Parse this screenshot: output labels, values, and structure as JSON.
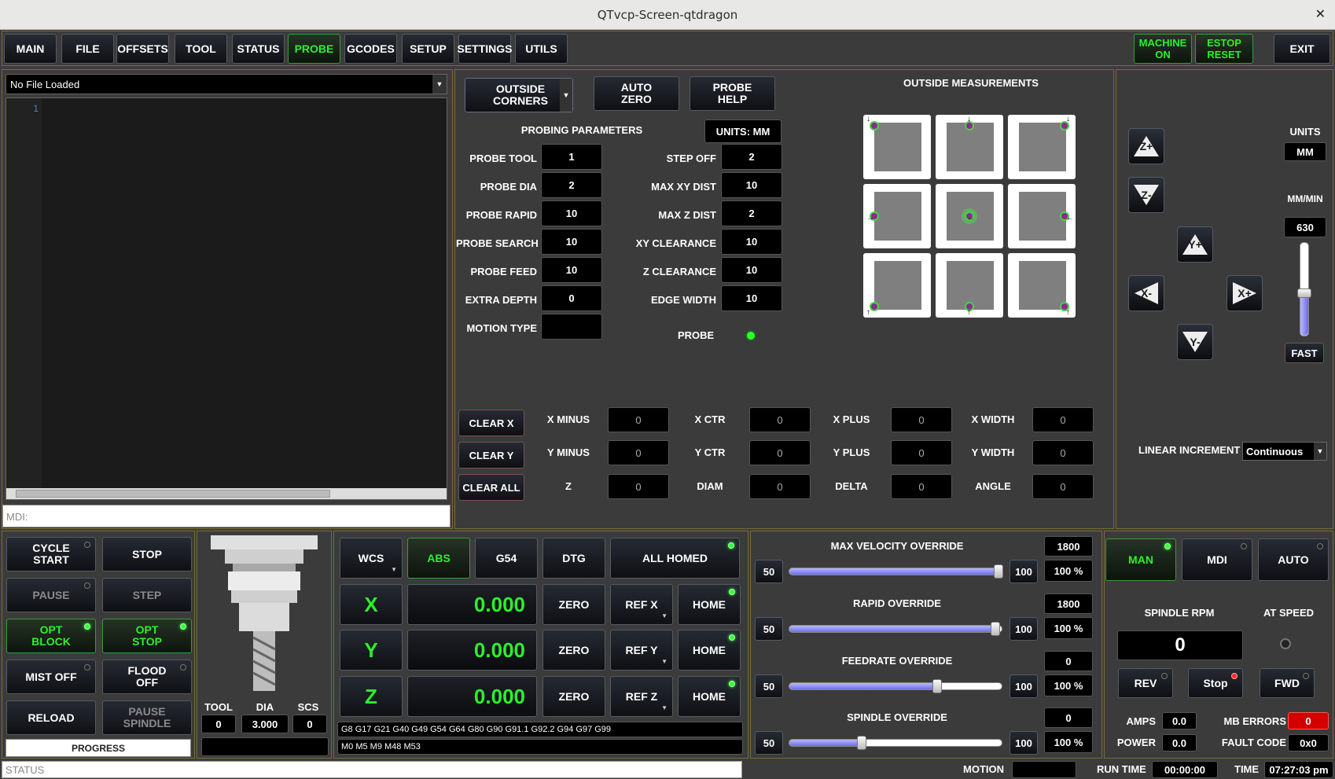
{
  "window": {
    "title": "QTvcp-Screen-qtdragon",
    "close": "✕"
  },
  "nav": {
    "tabs": [
      "MAIN",
      "FILE",
      "OFFSETS",
      "TOOL",
      "STATUS",
      "PROBE",
      "GCODES",
      "SETUP",
      "SETTINGS",
      "UTILS"
    ],
    "active": "PROBE",
    "machine_on": "MACHINE ON",
    "estop": "ESTOP RESET",
    "exit": "EXIT"
  },
  "file": {
    "loaded": "No File Loaded",
    "line1": "1",
    "mdi": "MDI:"
  },
  "probe": {
    "mode": "OUTSIDE CORNERS",
    "auto_zero": "AUTO ZERO",
    "help": "PROBE HELP",
    "params_title": "PROBING PARAMETERS",
    "units": "UNITS: MM",
    "left": [
      {
        "label": "PROBE TOOL",
        "value": "1"
      },
      {
        "label": "PROBE DIA",
        "value": "2"
      },
      {
        "label": "PROBE RAPID",
        "value": "10"
      },
      {
        "label": "PROBE SEARCH",
        "value": "10"
      },
      {
        "label": "PROBE FEED",
        "value": "10"
      },
      {
        "label": "EXTRA DEPTH",
        "value": "0"
      },
      {
        "label": "MOTION TYPE",
        "value": ""
      }
    ],
    "right": [
      {
        "label": "STEP OFF",
        "value": "2"
      },
      {
        "label": "MAX XY DIST",
        "value": "10"
      },
      {
        "label": "MAX Z DIST",
        "value": "2"
      },
      {
        "label": "XY CLEARANCE",
        "value": "10"
      },
      {
        "label": "Z CLEARANCE",
        "value": "10"
      },
      {
        "label": "EDGE WIDTH",
        "value": "10"
      }
    ],
    "probe_label": "PROBE",
    "measure_title": "OUTSIDE MEASUREMENTS",
    "clear_x": "CLEAR X",
    "clear_y": "CLEAR Y",
    "clear_all": "CLEAR ALL",
    "results": [
      [
        {
          "label": "X MINUS",
          "value": "0"
        },
        {
          "label": "X CTR",
          "value": "0"
        },
        {
          "label": "X PLUS",
          "value": "0"
        },
        {
          "label": "X WIDTH",
          "value": "0"
        }
      ],
      [
        {
          "label": "Y MINUS",
          "value": "0"
        },
        {
          "label": "Y CTR",
          "value": "0"
        },
        {
          "label": "Y PLUS",
          "value": "0"
        },
        {
          "label": "Y WIDTH",
          "value": "0"
        }
      ],
      [
        {
          "label": "Z",
          "value": "0"
        },
        {
          "label": "DIAM",
          "value": "0"
        },
        {
          "label": "DELTA",
          "value": "0"
        },
        {
          "label": "ANGLE",
          "value": "0"
        }
      ]
    ]
  },
  "jog": {
    "units_label": "UNITS",
    "units": "MM",
    "rate_label": "MM/MIN",
    "rate": "630",
    "fast": "FAST",
    "zplus": "Z+",
    "zminus": "Z-",
    "yplus": "Y+",
    "yminus": "Y-",
    "xplus": "X+",
    "xminus": "X-",
    "increment_label": "LINEAR INCREMENT",
    "increment": "Continuous",
    "slider_fraction": 0.45
  },
  "controls": {
    "cycle_start": "CYCLE START",
    "stop": "STOP",
    "pause": "PAUSE",
    "step": "STEP",
    "opt_block": "OPT BLOCK",
    "opt_stop": "OPT STOP",
    "mist": "MIST OFF",
    "flood": "FLOOD OFF",
    "reload": "RELOAD",
    "pause_spindle": "PAUSE SPINDLE",
    "progress": "PROGRESS"
  },
  "tool": {
    "tool_label": "TOOL",
    "dia_label": "DIA",
    "scs_label": "SCS",
    "tool": "0",
    "dia": "3.000",
    "scs": "0"
  },
  "dro": {
    "wcs": "WCS",
    "abs": "ABS",
    "g54": "G54",
    "dtg": "DTG",
    "all_homed": "ALL HOMED",
    "axes": [
      {
        "axis": "X",
        "value": "0.000",
        "ref": "REF X"
      },
      {
        "axis": "Y",
        "value": "0.000",
        "ref": "REF Y"
      },
      {
        "axis": "Z",
        "value": "0.000",
        "ref": "REF Z"
      }
    ],
    "zero": "ZERO",
    "home": "HOME",
    "gcodes": "G8 G17 G21 G40 G49 G54 G64 G80 G90 G91.1 G92.2 G94 G97 G99",
    "mcodes": "M0 M5 M9 M48 M53"
  },
  "overrides": [
    {
      "title": "MAX VELOCITY OVERRIDE",
      "value": "1800",
      "min": "50",
      "max": "100",
      "pct": "100 %",
      "fraction": 1.0
    },
    {
      "title": "RAPID OVERRIDE",
      "value": "1800",
      "min": "50",
      "max": "100",
      "pct": "100 %",
      "fraction": 0.985
    },
    {
      "title": "FEEDRATE OVERRIDE",
      "value": "0",
      "min": "50",
      "max": "100",
      "pct": "100 %",
      "fraction": 0.7
    },
    {
      "title": "SPINDLE OVERRIDE",
      "value": "0",
      "min": "50",
      "max": "100",
      "pct": "100 %",
      "fraction": 0.33
    }
  ],
  "spindle": {
    "man": "MAN",
    "mdi": "MDI",
    "auto": "AUTO",
    "rpm_label": "SPINDLE RPM",
    "at_speed": "AT SPEED",
    "rpm": "0",
    "rev": "REV",
    "stop": "Stop",
    "fwd": "FWD",
    "amps_label": "AMPS",
    "amps": "0.0",
    "power_label": "POWER",
    "power": "0.0",
    "mb_errors_label": "MB ERRORS",
    "mb_errors": "0",
    "fault_label": "FAULT CODE",
    "fault": "0x0"
  },
  "statusbar": {
    "status": "STATUS",
    "motion_label": "MOTION",
    "motion": "",
    "run_time_label": "RUN TIME",
    "run_time": "00:00:00",
    "time_label": "TIME",
    "time": "07:27:03 pm"
  },
  "colors": {
    "accent_green": "#2cf02c",
    "panel_border": "#7a6a3a",
    "error_red": "#d40000"
  }
}
